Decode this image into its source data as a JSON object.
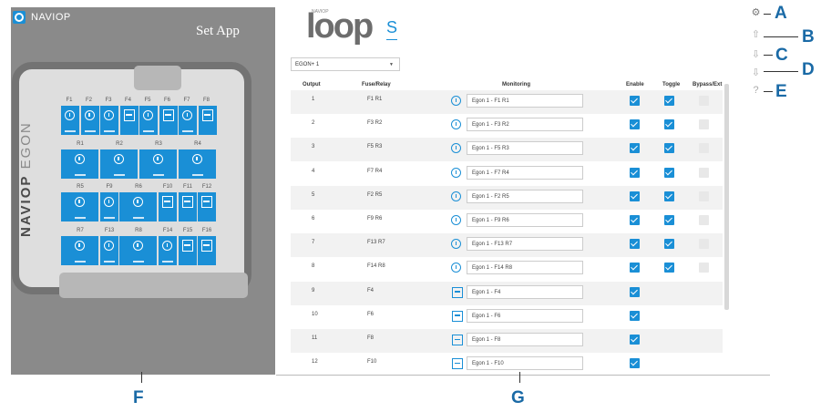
{
  "left_panel": {
    "brand": "NAVIOP",
    "title": "Set App",
    "vertical_logo": {
      "brand": "NAVIOP",
      "product": "EGON"
    },
    "fuse_labels_row1": [
      "F1",
      "F2",
      "F3",
      "F4",
      "F5",
      "F6",
      "F7",
      "F8"
    ],
    "relay_labels_row2": [
      "R1",
      "R2",
      "R3",
      "R4"
    ],
    "labels_row3": [
      "R5",
      "F9",
      "R6",
      "F10",
      "F11",
      "F12"
    ],
    "labels_row4": [
      "R7",
      "F13",
      "R8",
      "F14",
      "F15",
      "F16"
    ]
  },
  "header": {
    "logo_small": "NAVIOP",
    "logo_main": "loop",
    "logo_suffix": "S"
  },
  "device_select": {
    "value": "EGON+ 1"
  },
  "table": {
    "columns": [
      "Output",
      "Fuse/Relay",
      "Monitoring",
      "Enable",
      "Toggle",
      "Bypass/Ext"
    ],
    "rows": [
      {
        "output": "1",
        "fuse": "F1 R1",
        "icon": "power-icon",
        "monitor": "Egon 1 - F1 R1",
        "enable": true,
        "toggle": true,
        "bypass": false,
        "has_toggle": true
      },
      {
        "output": "2",
        "fuse": "F3 R2",
        "icon": "power-icon",
        "monitor": "Egon 1 - F3 R2",
        "enable": true,
        "toggle": true,
        "bypass": false,
        "has_toggle": true
      },
      {
        "output": "3",
        "fuse": "F5 R3",
        "icon": "power-icon",
        "monitor": "Egon 1 - F5 R3",
        "enable": true,
        "toggle": true,
        "bypass": false,
        "has_toggle": true
      },
      {
        "output": "4",
        "fuse": "F7 R4",
        "icon": "power-icon",
        "monitor": "Egon 1 - F7 R4",
        "enable": true,
        "toggle": true,
        "bypass": false,
        "has_toggle": true
      },
      {
        "output": "5",
        "fuse": "F2 R5",
        "icon": "power-icon",
        "monitor": "Egon 1 - F2 R5",
        "enable": true,
        "toggle": true,
        "bypass": false,
        "has_toggle": true
      },
      {
        "output": "6",
        "fuse": "F9 R6",
        "icon": "power-icon",
        "monitor": "Egon 1 - F9 R6",
        "enable": true,
        "toggle": true,
        "bypass": false,
        "has_toggle": true
      },
      {
        "output": "7",
        "fuse": "F13 R7",
        "icon": "power-icon",
        "monitor": "Egon 1 - F13 R7",
        "enable": true,
        "toggle": true,
        "bypass": false,
        "has_toggle": true
      },
      {
        "output": "8",
        "fuse": "F14 R8",
        "icon": "power-icon",
        "monitor": "Egon 1 - F14 R8",
        "enable": true,
        "toggle": true,
        "bypass": false,
        "has_toggle": true
      },
      {
        "output": "9",
        "fuse": "F4",
        "icon": "fuse-icon",
        "monitor": "Egon 1 - F4",
        "enable": true,
        "has_toggle": false
      },
      {
        "output": "10",
        "fuse": "F6",
        "icon": "fuse-icon",
        "monitor": "Egon 1 - F6",
        "enable": true,
        "has_toggle": false
      },
      {
        "output": "11",
        "fuse": "F8",
        "icon": "fuse-icon",
        "monitor": "Egon 1 - F8",
        "enable": true,
        "has_toggle": false
      },
      {
        "output": "12",
        "fuse": "F10",
        "icon": "fuse-icon",
        "monitor": "Egon 1 - F10",
        "enable": true,
        "has_toggle": false
      }
    ]
  },
  "callouts": {
    "A": "A",
    "B": "B",
    "C": "C",
    "D": "D",
    "E": "E",
    "F": "F",
    "G": "G"
  },
  "right_icons": [
    "settings-icon",
    "upload-icon",
    "download-icon",
    "download-alt-icon",
    "help-icon"
  ],
  "colors": {
    "accent": "#1a8fd6",
    "panel_gray": "#8a8a8a",
    "callout": "#1a6aa6"
  }
}
